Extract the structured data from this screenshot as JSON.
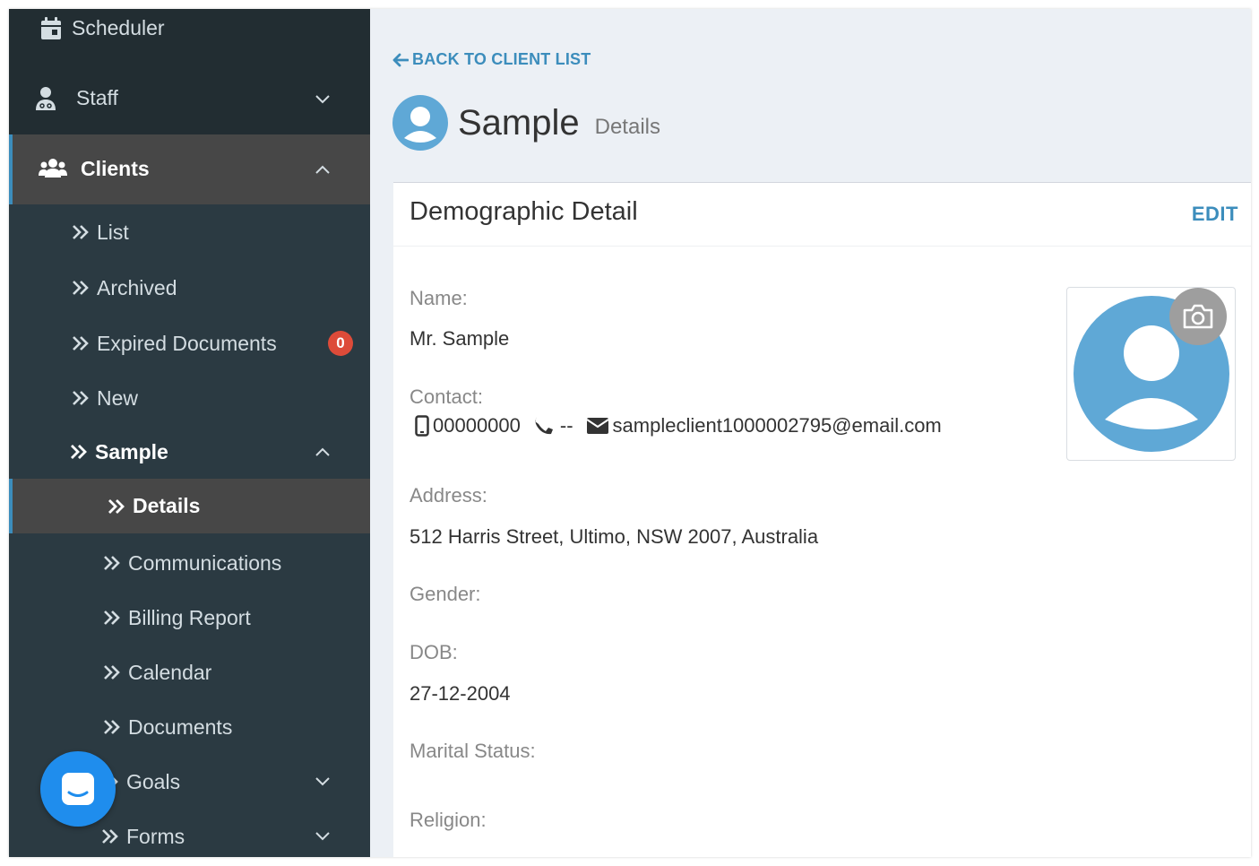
{
  "sidebar": {
    "scheduler": "Scheduler",
    "staff": "Staff",
    "clients": "Clients",
    "client_items": {
      "list": "List",
      "archived": "Archived",
      "expired": "Expired Documents",
      "expired_badge": "0",
      "new": "New",
      "sample": "Sample"
    },
    "sample_items": {
      "details": "Details",
      "communications": "Communications",
      "billing": "Billing Report",
      "calendar": "Calendar",
      "documents": "Documents",
      "goals": "Goals",
      "forms": "Forms"
    }
  },
  "header": {
    "back_link": "BACK TO CLIENT LIST",
    "title": "Sample",
    "subtitle": "Details"
  },
  "card": {
    "title": "Demographic Detail",
    "edit": "EDIT",
    "fields": {
      "name_label": "Name:",
      "name_value": "Mr. Sample",
      "contact_label": "Contact:",
      "mobile": "00000000",
      "phone": "--",
      "email": "sampleclient1000002795@email.com",
      "address_label": "Address:",
      "address_value": "512 Harris Street, Ultimo, NSW 2007, Australia",
      "gender_label": "Gender:",
      "dob_label": "DOB:",
      "dob_value": "27-12-2004",
      "marital_label": "Marital Status:",
      "religion_label": "Religion:"
    }
  },
  "colors": {
    "sidebar_bg": "#2b3a42",
    "active_bg": "#474747",
    "accent": "#3c8dbc",
    "avatar": "#5fa8d6",
    "badge": "#dd4b39",
    "chat": "#1f8ded"
  }
}
